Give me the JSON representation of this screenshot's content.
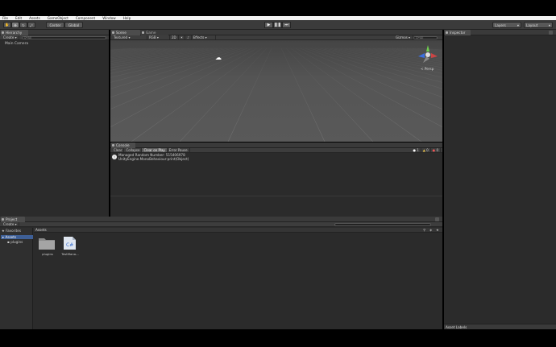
{
  "menu": [
    "File",
    "Edit",
    "Assets",
    "GameObject",
    "Component",
    "Window",
    "Help"
  ],
  "toolbar": {
    "center_label": "Center",
    "global_label": "Global",
    "layers_label": "Layers",
    "layout_label": "Layout"
  },
  "hierarchy": {
    "tab": "Hierarchy",
    "create_label": "Create",
    "search_placeholder": "Q•All",
    "items": [
      "Main Camera"
    ]
  },
  "scene": {
    "tab_scene": "Scene",
    "tab_game": "Game",
    "shading": "Textured",
    "render": "RGB",
    "mode_2d": "2D",
    "effects": "Effects",
    "gizmos": "Gizmos",
    "search": "Q•All",
    "persp_label": "< Persp"
  },
  "console": {
    "tab": "Console",
    "buttons": [
      "Clear",
      "Collapse",
      "Clear on Play",
      "Error Pause"
    ],
    "counts": [
      "1",
      "0",
      "0"
    ],
    "entry_line1": "Managed Random Number: 515406978",
    "entry_line2": "UnityEngine.MonoBehaviour:print(Object)"
  },
  "project": {
    "tab": "Project",
    "create_label": "Create",
    "favorites_label": "Favorites",
    "tree": [
      "Assets",
      "plugins"
    ],
    "breadcrumb": "Assets",
    "assets": [
      {
        "name": "plugins",
        "kind": "folder"
      },
      {
        "name": "TestMana...",
        "kind": "csharp"
      }
    ]
  },
  "inspector": {
    "tab": "Inspector",
    "asset_labels": "Asset Labels"
  }
}
